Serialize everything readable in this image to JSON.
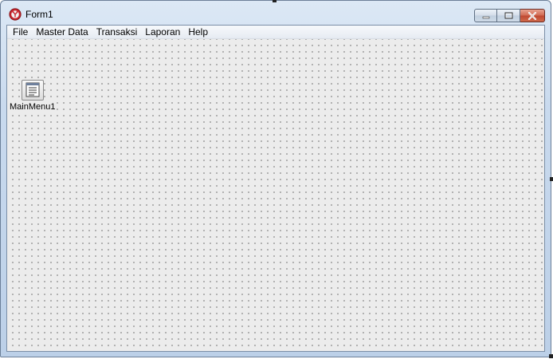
{
  "window": {
    "title": "Form1",
    "icon": "delphi-app-icon",
    "buttons": [
      "minimize-icon",
      "maximize-icon",
      "close-icon"
    ]
  },
  "menubar": {
    "items": [
      {
        "label": "File"
      },
      {
        "label": "Master Data"
      },
      {
        "label": "Transaksi"
      },
      {
        "label": "Laporan"
      },
      {
        "label": "Help"
      }
    ]
  },
  "components": [
    {
      "name": "MainMenu1",
      "icon": "main-menu-component-icon"
    }
  ],
  "colors": {
    "titlebar": "#c9daee",
    "client": "#ececec",
    "close_button": "#c04a32"
  }
}
